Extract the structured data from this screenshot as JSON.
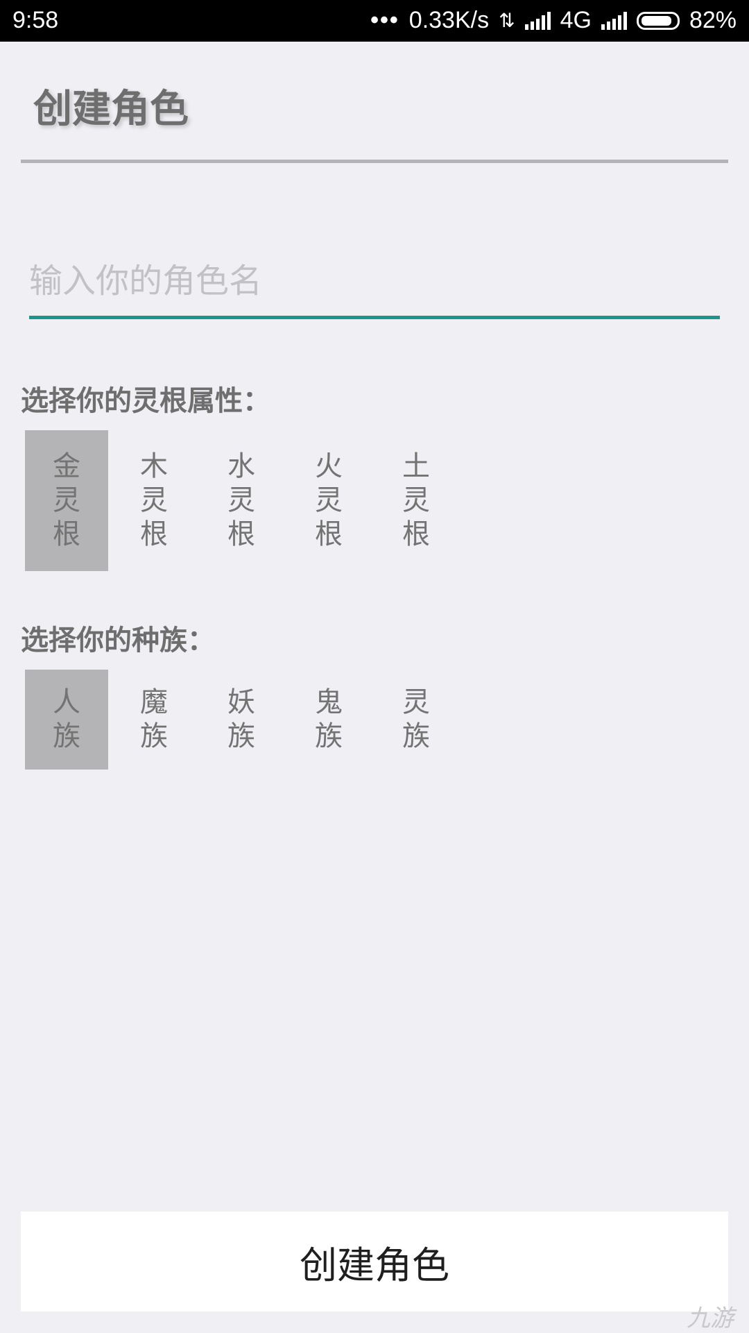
{
  "status_bar": {
    "time": "9:58",
    "dots": "•••",
    "network_speed": "0.33K/s",
    "network_type": "4G",
    "battery_percent": "82%",
    "icons": [
      "data-arrows-icon",
      "signal-icon",
      "signal-icon",
      "battery-icon"
    ]
  },
  "header": {
    "title": "创建角色"
  },
  "name_input": {
    "placeholder": "输入你的角色名",
    "value": "",
    "underline_color": "#1a978a"
  },
  "spirit_root": {
    "label": "选择你的灵根属性：",
    "selected_index": 0,
    "options": [
      {
        "chars": [
          "金",
          "灵",
          "根"
        ]
      },
      {
        "chars": [
          "木",
          "灵",
          "根"
        ]
      },
      {
        "chars": [
          "水",
          "灵",
          "根"
        ]
      },
      {
        "chars": [
          "火",
          "灵",
          "根"
        ]
      },
      {
        "chars": [
          "土",
          "灵",
          "根"
        ]
      }
    ]
  },
  "race": {
    "label": "选择你的种族：",
    "selected_index": 0,
    "options": [
      {
        "chars": [
          "人",
          "族"
        ]
      },
      {
        "chars": [
          "魔",
          "族"
        ]
      },
      {
        "chars": [
          "妖",
          "族"
        ]
      },
      {
        "chars": [
          "鬼",
          "族"
        ]
      },
      {
        "chars": [
          "灵",
          "族"
        ]
      }
    ]
  },
  "create_button": {
    "label": "创建角色"
  },
  "watermark": {
    "text": "九游"
  },
  "colors": {
    "background": "#efeff4",
    "selected_option": "#b4b4b6",
    "accent": "#1a978a"
  }
}
